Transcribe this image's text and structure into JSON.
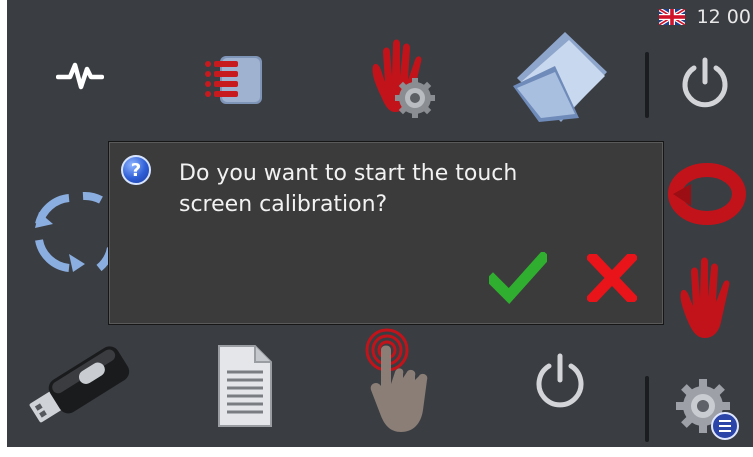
{
  "status_bar": {
    "language_flag": "uk-flag-icon",
    "clock": "12 00"
  },
  "menu_icons": [
    "signal-icon",
    "list-icon",
    "hand-settings-icon",
    "folder-icon",
    "power-icon",
    "refresh-icon",
    "rotate-icon",
    "hand-icon",
    "usb-drive-icon",
    "document-icon",
    "touch-icon",
    "shutdown-icon",
    "settings-icon"
  ],
  "dialog": {
    "icon": "question-icon",
    "message_line1": "Do you want to start the touch",
    "message_line2": "screen calibration?",
    "confirm_icon": "checkmark-icon",
    "cancel_icon": "cross-icon"
  },
  "colors": {
    "screen_bg": "#3a3d42",
    "dialog_bg": "#3b3b3b",
    "confirm": "#2fae2f",
    "cancel": "#e8141a",
    "accent_red": "#c3131a"
  }
}
